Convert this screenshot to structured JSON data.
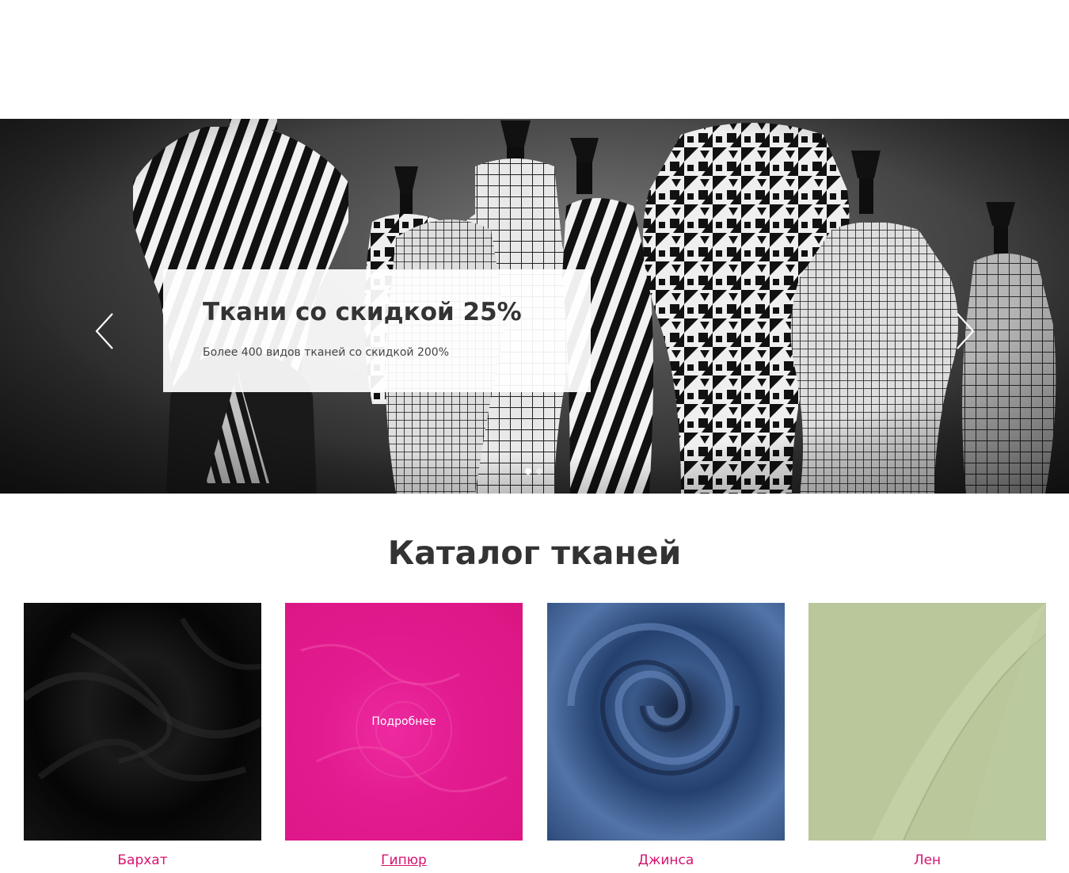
{
  "slider": {
    "title": "Ткани со скидкой 25%",
    "subtitle": "Более 400 видов тканей со скидкой 200%",
    "slide_count": 2,
    "active_slide": 1
  },
  "catalog": {
    "title": "Каталог тканей",
    "items": [
      {
        "name": "Бархат",
        "color": "#111111"
      },
      {
        "name": "Гипюр",
        "color": "#e21b8f",
        "overlay": "Подробнее"
      },
      {
        "name": "Джинса",
        "color": "#3a5a8c"
      },
      {
        "name": "Лен",
        "color": "#b9c79b"
      }
    ]
  },
  "colors": {
    "accent": "#d6146f",
    "heading": "#333333"
  }
}
